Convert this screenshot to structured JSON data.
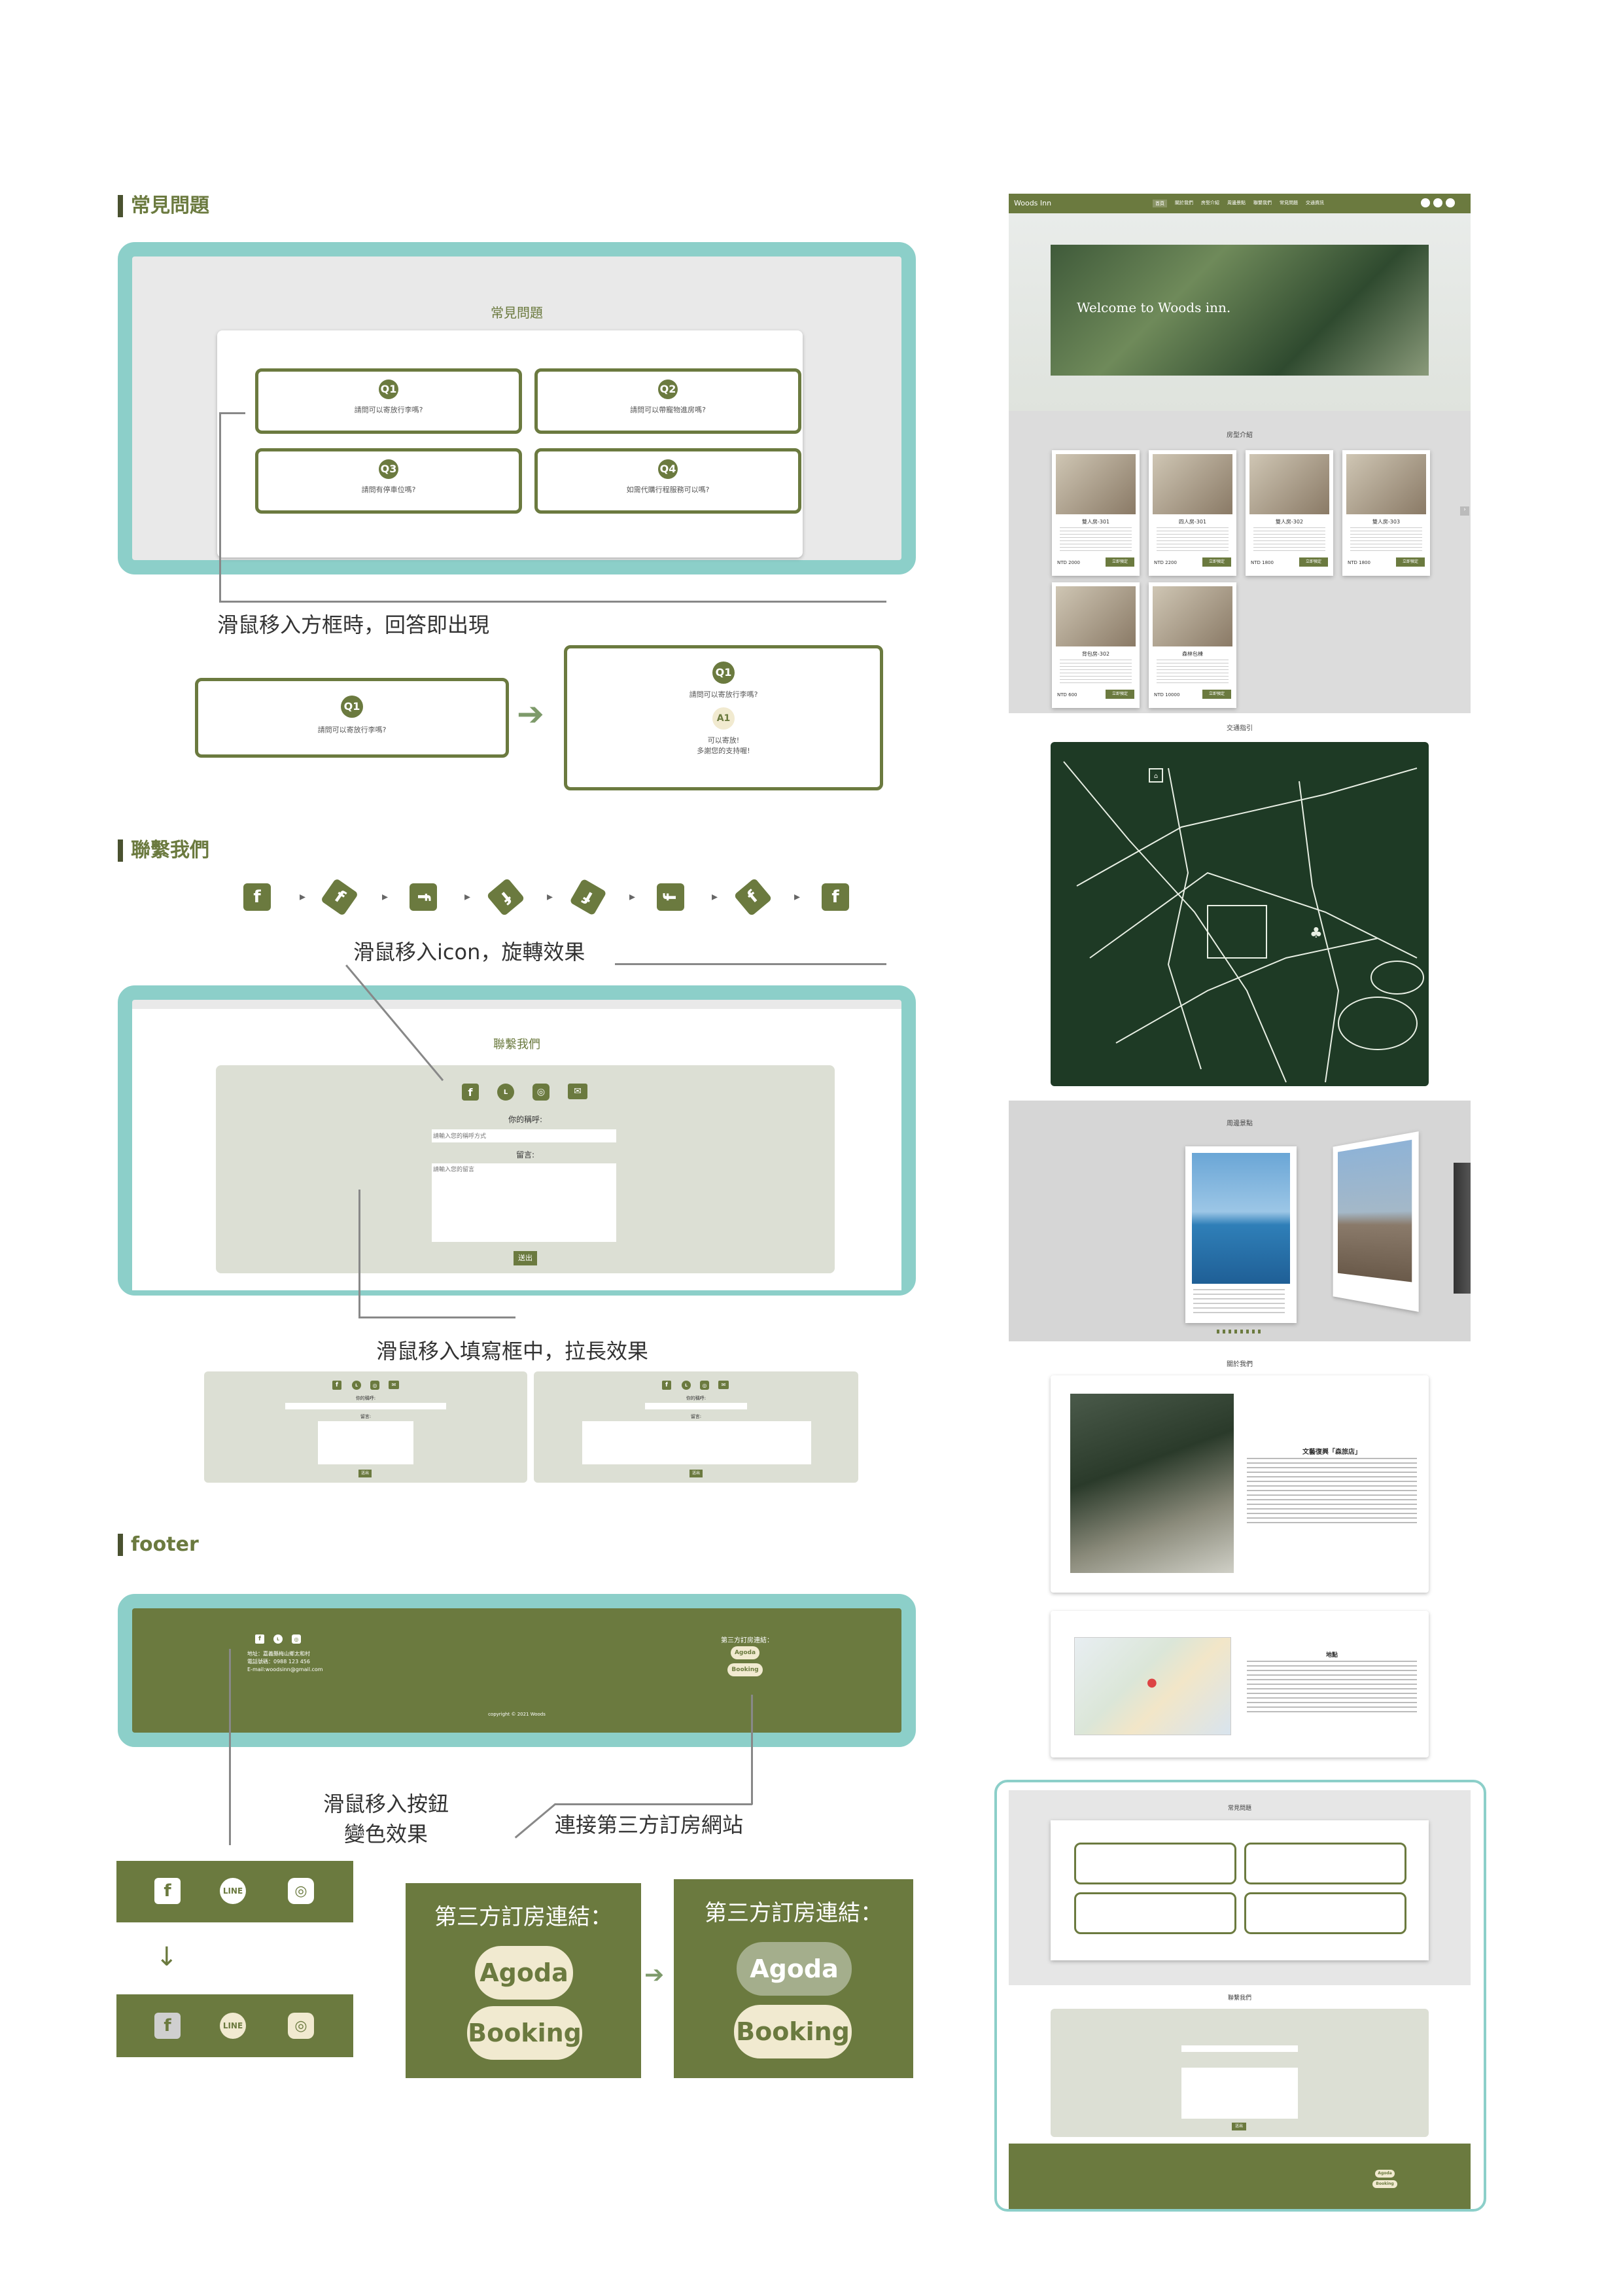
{
  "sections": {
    "faq": "常見問題",
    "contact": "聯繫我們",
    "footer": "footer"
  },
  "faq": {
    "panel_title": "常見問題",
    "questions": [
      {
        "badge": "Q1",
        "text": "請問可以寄放行李嗎?"
      },
      {
        "badge": "Q2",
        "text": "請問可以帶寵物進房嗎?"
      },
      {
        "badge": "Q3",
        "text": "請問有停車位嗎?"
      },
      {
        "badge": "Q4",
        "text": "如需代購行程服務可以嗎?"
      }
    ],
    "hover_caption": "滑鼠移入方框時，回答即出現",
    "demo_before": {
      "badge": "Q1",
      "text": "請問可以寄放行李嗎?"
    },
    "demo_after": {
      "badge": "Q1",
      "text": "請問可以寄放行李嗎?",
      "answer_badge": "A1",
      "answer_line1": "可以寄放!",
      "answer_line2": "多謝您的支持喔!"
    }
  },
  "contact": {
    "rotate_caption": "滑鼠移入icon，旋轉效果",
    "panel_title": "聯繫我們",
    "name_label": "你的稱呼:",
    "name_placeholder": "請輸入您的稱呼方式",
    "message_label": "留言:",
    "message_placeholder": "請輸入您的留言",
    "submit": "送出",
    "stretch_caption": "滑鼠移入填寫框中，拉長效果"
  },
  "footer": {
    "address_line1": "地址：嘉義縣梅山鄉太和村",
    "address_line2": "電話號碼：0988 123 456",
    "address_line3": "E-mail:woodsinn@gmail.com",
    "third_party_label": "第三方訂房連結：",
    "agoda": "Agoda",
    "booking": "Booking",
    "copyright": "copyright © 2021 Woods",
    "hover_caption_line1": "滑鼠移入按鈕",
    "hover_caption_line2": "變色效果",
    "link_caption": "連接第三方訂房網站",
    "big_label": "第三方訂房連結："
  },
  "site": {
    "logo": "Woods Inn",
    "nav": [
      "首頁",
      "關於我們",
      "房型介紹",
      "周邊景點",
      "聯繫我們",
      "常見問題",
      "交通資訊"
    ],
    "hero_text": "Welcome to Woods inn.",
    "rooms_title": "房型介紹",
    "rooms": [
      {
        "name": "雙人房-301",
        "price": "NTD 2000",
        "btn": "立即預定"
      },
      {
        "name": "四人房-301",
        "price": "NTD 2200",
        "btn": "立即預定"
      },
      {
        "name": "雙人房-302",
        "price": "NTD 1800",
        "btn": "立即預定"
      },
      {
        "name": "雙人房-303",
        "price": "NTD 1800",
        "btn": "立即預定"
      },
      {
        "name": "背包房-302",
        "price": "NTD 600",
        "btn": "立即預定"
      },
      {
        "name": "森林包棟",
        "price": "NTD 10000",
        "btn": "立即預定"
      }
    ],
    "map_title": "交通指引",
    "gallery_title": "周邊景點",
    "about_title": "關於我們",
    "about_heading": "文藝復興「森旅店」",
    "location_title": "地點",
    "faq_title": "常見問題",
    "contact_title": "聯繫我們",
    "submit": "送出",
    "agoda": "Agoda",
    "booking": "Booking"
  },
  "colors": {
    "olive": "#6b7a3f",
    "teal": "#8ccfc9",
    "cream": "#f1ead0",
    "dark_green": "#1e3a25"
  }
}
